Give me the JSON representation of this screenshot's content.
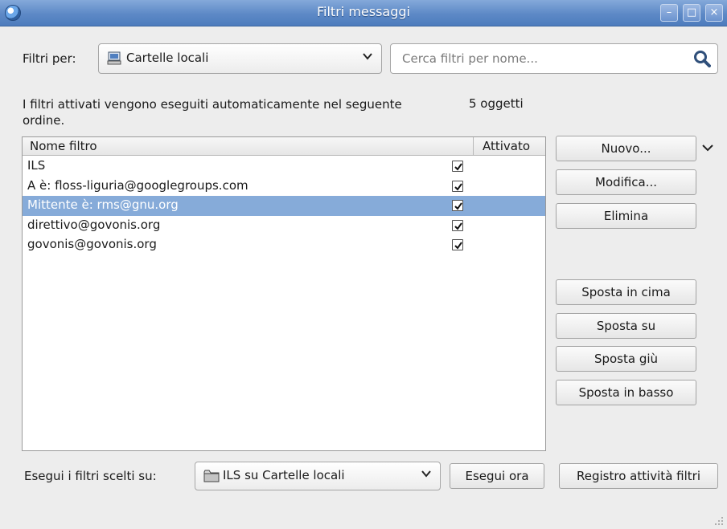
{
  "window": {
    "title": "Filtri messaggi",
    "controls": {
      "minimize": "–",
      "maximize": "□",
      "close": "×"
    }
  },
  "filter_for": {
    "label": "Filtri per:",
    "account": "Cartelle locali"
  },
  "search": {
    "placeholder": "Cerca filtri per nome...",
    "value": ""
  },
  "info": {
    "text": "I filtri attivati vengono eseguiti automaticamente nel seguente ordine.",
    "count": "5 oggetti"
  },
  "list": {
    "headers": {
      "name": "Nome filtro",
      "enabled": "Attivato"
    },
    "rows": [
      {
        "name": "ILS",
        "enabled": true,
        "selected": false
      },
      {
        "name": "A è: floss-liguria@googlegroups.com",
        "enabled": true,
        "selected": false
      },
      {
        "name": "Mittente è: rms@gnu.org",
        "enabled": true,
        "selected": true
      },
      {
        "name": "direttivo@govonis.org",
        "enabled": true,
        "selected": false
      },
      {
        "name": "govonis@govonis.org",
        "enabled": true,
        "selected": false
      }
    ]
  },
  "buttons": {
    "new": "Nuovo...",
    "edit": "Modifica...",
    "delete": "Elimina",
    "move_top": "Sposta in cima",
    "move_up": "Sposta su",
    "move_down": "Sposta giù",
    "move_bottom": "Sposta in basso",
    "run_now": "Esegui ora",
    "log": "Registro attività filtri"
  },
  "run_on": {
    "label": "Esegui i filtri scelti su:",
    "folder": "ILS su Cartelle locali"
  },
  "colors": {
    "titlebar": "#5d89c6",
    "selection": "#86abd9",
    "background": "#ededed"
  },
  "icons": {
    "app": "thunderbird-icon",
    "account": "local-folders-icon",
    "folder": "folder-icon",
    "search": "search-icon",
    "dropdown": "chevron-down-icon"
  }
}
